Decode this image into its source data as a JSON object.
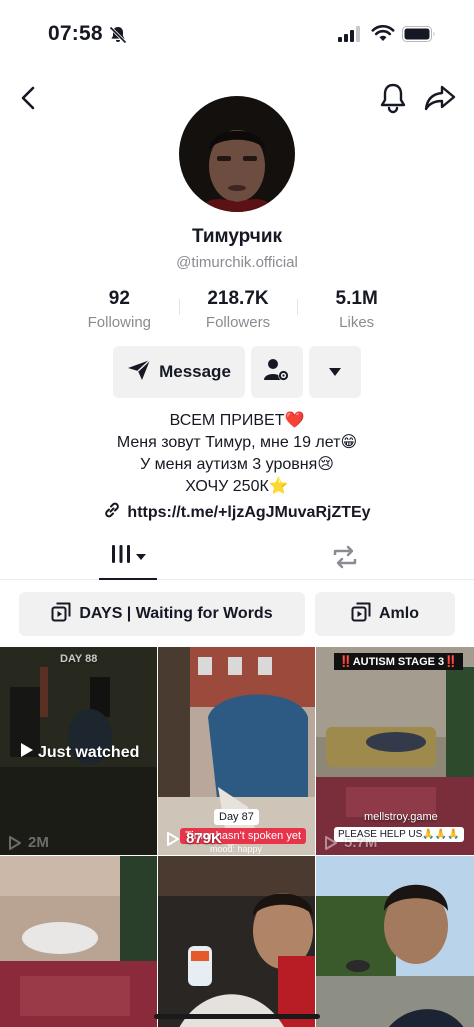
{
  "status_bar": {
    "time": "07:58",
    "icons": [
      "bell-slash-icon",
      "cellular-signal-icon",
      "wifi-icon",
      "battery-icon"
    ]
  },
  "nav": {
    "icons": [
      "back-arrow-icon",
      "bell-icon",
      "share-icon"
    ]
  },
  "profile": {
    "display_name": "Тимурчик",
    "username": "@timurchik.official",
    "stats": [
      {
        "value": "92",
        "label": "Following"
      },
      {
        "value": "218.7K",
        "label": "Followers"
      },
      {
        "value": "5.1M",
        "label": "Likes"
      }
    ],
    "message_label": "Message",
    "bio_lines": [
      "ВСЕМ ПРИВЕТ❤️",
      "Меня зовут Тимур, мне 19 лет😁",
      "У меня аутизм 3 уровня😢",
      "ХОЧУ 250К⭐"
    ],
    "link": "https://t.me/+ljzAgJMuvaRjZTEy"
  },
  "tabs": {
    "icons": [
      "videos-grid-icon",
      "reposts-icon"
    ]
  },
  "playlists": [
    {
      "label": "DAYS | Waiting for Words"
    },
    {
      "label": "Amlo"
    }
  ],
  "videos": [
    {
      "badge": "DAY 88",
      "overlay": "Just watched",
      "views": "2M"
    },
    {
      "badge": "Day 87",
      "caption": "Timur hasn't spoken yet",
      "subcaption": "mood: happy",
      "views": "879K"
    },
    {
      "badge": "‼️AUTISM STAGE 3‼️",
      "caption_top": "mellstroy.game",
      "caption": "PLEASE HELP US🙏🙏🙏",
      "views": "5.7M"
    },
    {},
    {},
    {}
  ],
  "colors": {
    "accent_red": "#fe2c55",
    "text_primary": "#161823",
    "text_secondary": "#8a8b91",
    "button_bg": "#f1f1f2"
  }
}
